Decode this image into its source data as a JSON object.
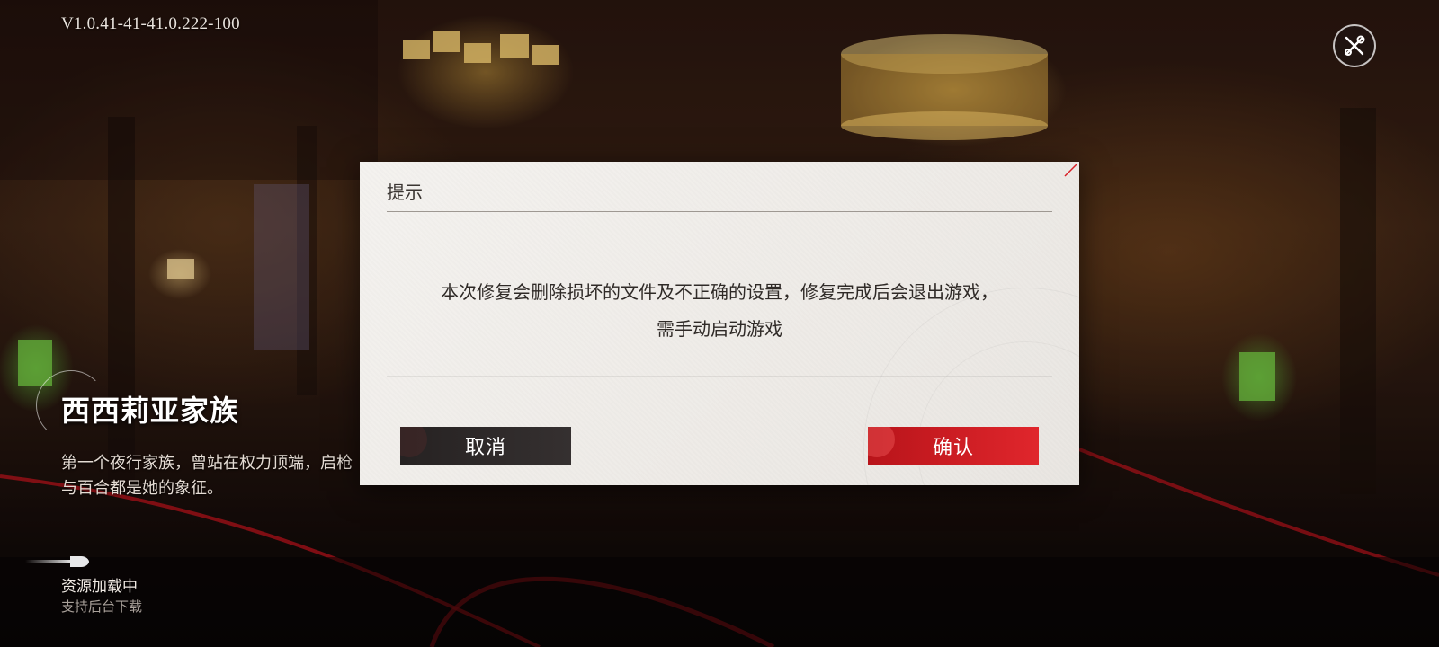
{
  "version": "V1.0.41-41-41.0.222-100",
  "tool_button": {
    "icon": "tools-icon"
  },
  "faction": {
    "title": "西西莉亚家族",
    "description": "第一个夜行家族，曾站在权力顶端，启枪与百合都是她的象征。"
  },
  "loading": {
    "title": "资源加载中",
    "subtitle": "支持后台下载"
  },
  "dialog": {
    "title": "提示",
    "message_line1": "本次修复会删除损坏的文件及不正确的设置，修复完成后会退出游戏，",
    "message_line2": "需手动启动游戏",
    "cancel_label": "取消",
    "confirm_label": "确认"
  },
  "colors": {
    "accent_red": "#d81f26",
    "cancel_dark": "#2e2929",
    "dialog_paper": "#f1eeeb"
  }
}
